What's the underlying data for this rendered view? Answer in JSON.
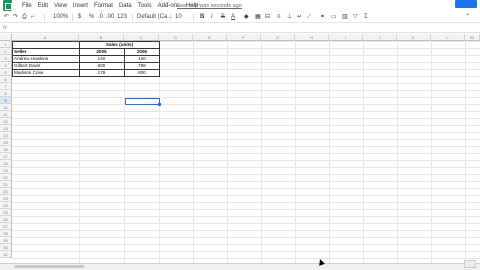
{
  "menu": {
    "items": [
      "File",
      "Edit",
      "View",
      "Insert",
      "Format",
      "Data",
      "Tools",
      "Add-ons",
      "Help"
    ],
    "last_edit": "Last edit was seconds ago"
  },
  "toolbar": {
    "zoom": "100%",
    "currency": "$",
    "percent": "%",
    "dec_decrease": ".0",
    "dec_increase": ".00",
    "more_formats": "123",
    "font": "Default (Ca...",
    "font_size": "10",
    "bold": "B",
    "italic": "I",
    "strike": "S",
    "text_color": "A"
  },
  "formula_bar": {
    "fx": "fx"
  },
  "columns": [
    "A",
    "B",
    "C",
    "D",
    "E",
    "F",
    "G",
    "H",
    "I",
    "J",
    "K",
    "L",
    "M"
  ],
  "rows": [
    "1",
    "2",
    "3",
    "4",
    "5",
    "6",
    "7",
    "8",
    "9",
    "10",
    "11",
    "12",
    "13",
    "14",
    "15",
    "16",
    "17",
    "18",
    "19",
    "20",
    "21",
    "22",
    "23",
    "24",
    "25",
    "26",
    "27",
    "28",
    "29",
    "30",
    "31"
  ],
  "sheet": {
    "merged_header": "Sales (units)",
    "headers": [
      "Seller",
      "2005",
      "2006"
    ],
    "data": [
      [
        "Andrew Hawkins",
        "140",
        "120"
      ],
      [
        "Gilbert Davis",
        "600",
        "788"
      ],
      [
        "Madison Crew",
        "178",
        "800"
      ]
    ]
  },
  "colors": {
    "accent": "#1a73e8",
    "brand": "#0f9d58"
  }
}
